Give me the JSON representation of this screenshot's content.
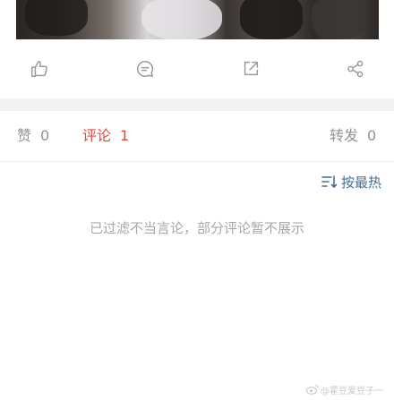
{
  "actions": {
    "like_icon": "thumbs-up-icon",
    "comment_icon": "comment-icon",
    "repost_icon": "share-out-icon",
    "share_icon": "share-nodes-icon"
  },
  "tabs": {
    "likes": {
      "label": "赞",
      "count": "0"
    },
    "comments": {
      "label": "评论",
      "count": "1"
    },
    "reposts": {
      "label": "转发",
      "count": "0"
    }
  },
  "sort": {
    "label": "按最热"
  },
  "notice": "已过滤不当言论，部分评论暂不展示",
  "watermark": "@霍豆爱豆子一",
  "colors": {
    "active_tab": "#e0483b",
    "inactive_tab": "#939393",
    "sort_link": "#4a6d91",
    "notice_text": "#a8a8a8",
    "divider_band": "#f2f2f2"
  }
}
